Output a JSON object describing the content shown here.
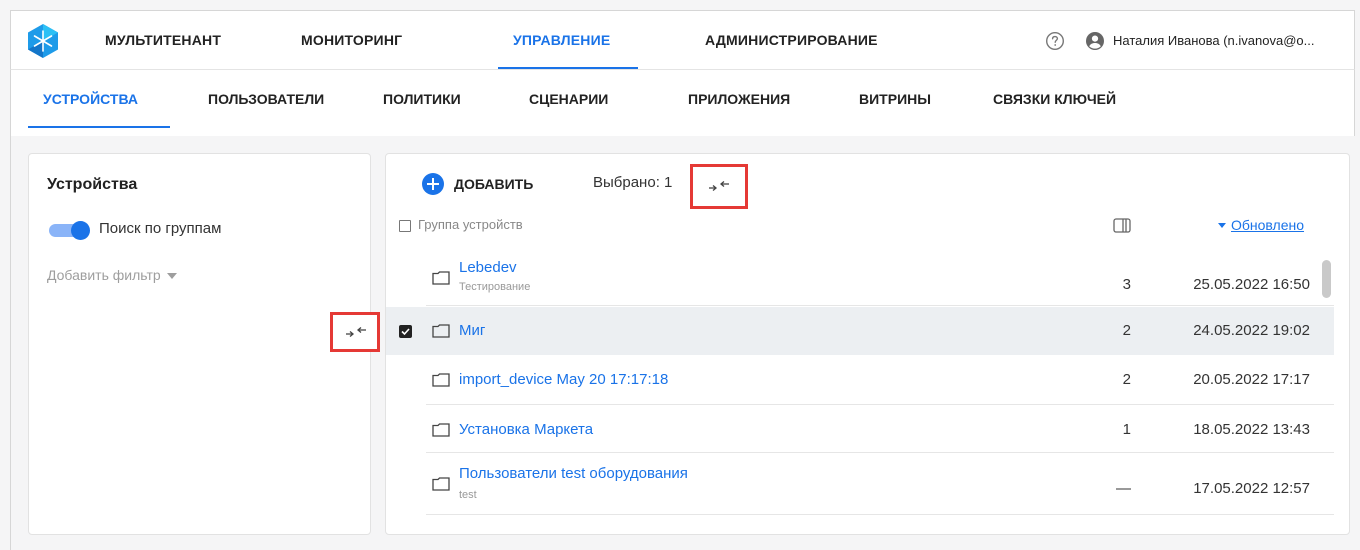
{
  "header": {
    "nav": [
      {
        "label": "МУЛЬТИТЕНАНТ",
        "active": false
      },
      {
        "label": "МОНИТОРИНГ",
        "active": false
      },
      {
        "label": "УПРАВЛЕНИЕ",
        "active": true
      },
      {
        "label": "АДМИНИСТРИРОВАНИЕ",
        "active": false
      }
    ],
    "user": "Наталия Иванова (n.ivanova@o...",
    "help_icon": "help-circle-icon",
    "user_icon": "account-circle-icon"
  },
  "subnav": [
    {
      "label": "УСТРОЙСТВА",
      "active": true
    },
    {
      "label": "ПОЛЬЗОВАТЕЛИ",
      "active": false
    },
    {
      "label": "ПОЛИТИКИ",
      "active": false
    },
    {
      "label": "СЦЕНАРИИ",
      "active": false
    },
    {
      "label": "ПРИЛОЖЕНИЯ",
      "active": false
    },
    {
      "label": "ВИТРИНЫ",
      "active": false
    },
    {
      "label": "СВЯЗКИ КЛЮЧЕЙ",
      "active": false
    }
  ],
  "left_panel": {
    "title": "Устройства",
    "toggle_label": "Поиск по группам",
    "toggle_on": true,
    "add_filter": "Добавить фильтр"
  },
  "toolbar": {
    "add_label": "ДОБАВИТЬ",
    "selected": "Выбрано: 1"
  },
  "table": {
    "header_label": "Группа устройств",
    "sort_label": "Обновлено",
    "rows": [
      {
        "name": "Lebedev",
        "sub": "Тестирование",
        "count": "3",
        "date": "25.05.2022 16:50",
        "selected": false
      },
      {
        "name": "Миг",
        "sub": "",
        "count": "2",
        "date": "24.05.2022 19:02",
        "selected": true
      },
      {
        "name": "import_device May 20 17:17:18",
        "sub": "",
        "count": "2",
        "date": "20.05.2022 17:17",
        "selected": false
      },
      {
        "name": "Установка Маркета",
        "sub": "",
        "count": "1",
        "date": "18.05.2022 13:43",
        "selected": false
      },
      {
        "name": "Пользователи test оборудования",
        "sub": "test",
        "count": "—",
        "date": "17.05.2022 12:57",
        "selected": false
      }
    ]
  },
  "colors": {
    "accent": "#1a73e8",
    "highlight_border": "#e53935",
    "selected_row": "#eceff2"
  }
}
